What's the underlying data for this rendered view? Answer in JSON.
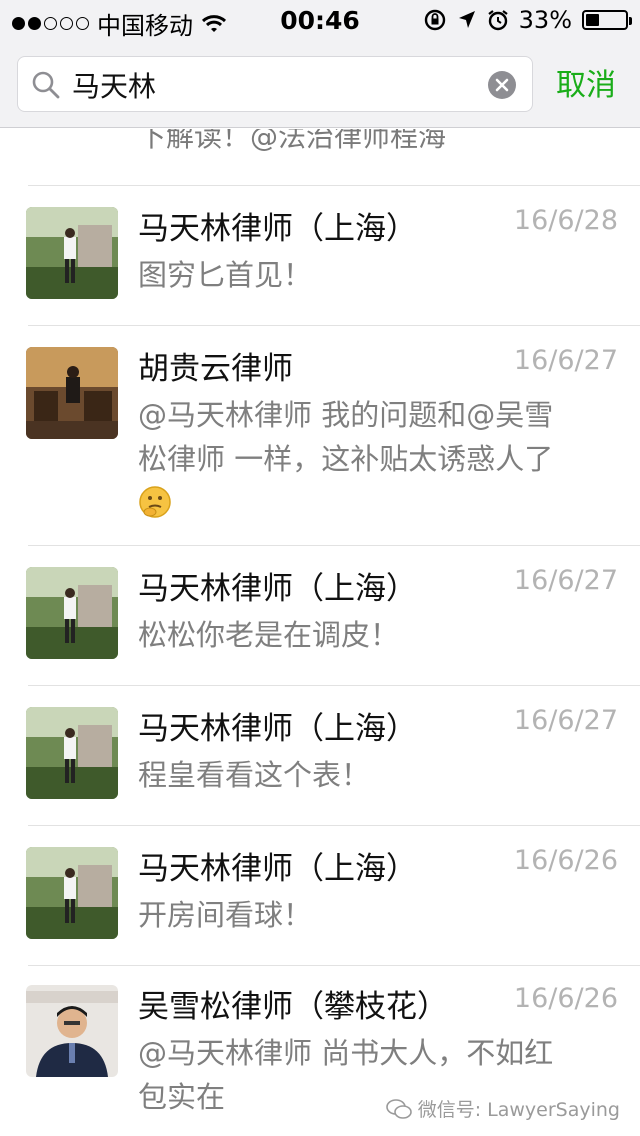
{
  "status_bar": {
    "carrier": "中国移动",
    "time": "00:46",
    "battery": "33%",
    "battery_level": 0.33,
    "signal_bars_filled": 2,
    "signal_bars_total": 5,
    "icons": [
      "wifi-icon",
      "rotation-lock-icon",
      "location-icon",
      "alarm-icon",
      "battery-icon"
    ]
  },
  "search": {
    "value": "马天林",
    "cancel_label": "取消",
    "accent_color": "#1aad19"
  },
  "list": {
    "cut_off_text": "下解读！@法治律师程海",
    "results": [
      {
        "name": "马天林律师（上海）",
        "date": "16/6/28",
        "message": "图穷匕首见！",
        "avatar": "garden-portrait"
      },
      {
        "name": "胡贵云律师",
        "date": "16/6/27",
        "message": "@马天林律师 我的问题和@吴雪松律师 一样，这补贴太诱惑人了",
        "emoji": "thinking-emoji",
        "avatar": "restaurant-portrait"
      },
      {
        "name": "马天林律师（上海）",
        "date": "16/6/27",
        "message": "松松你老是在调皮！",
        "avatar": "garden-portrait"
      },
      {
        "name": "马天林律师（上海）",
        "date": "16/6/27",
        "message": "程皇看看这个表！",
        "avatar": "garden-portrait"
      },
      {
        "name": "马天林律师（上海）",
        "date": "16/6/26",
        "message": "开房间看球！",
        "avatar": "garden-portrait"
      },
      {
        "name": "吴雪松律师（攀枝花）",
        "date": "16/6/26",
        "message": "@马天林律师 尚书大人，不如红包实在",
        "avatar": "speaker-portrait"
      }
    ]
  },
  "watermark": "微信号: LawyerSaying"
}
